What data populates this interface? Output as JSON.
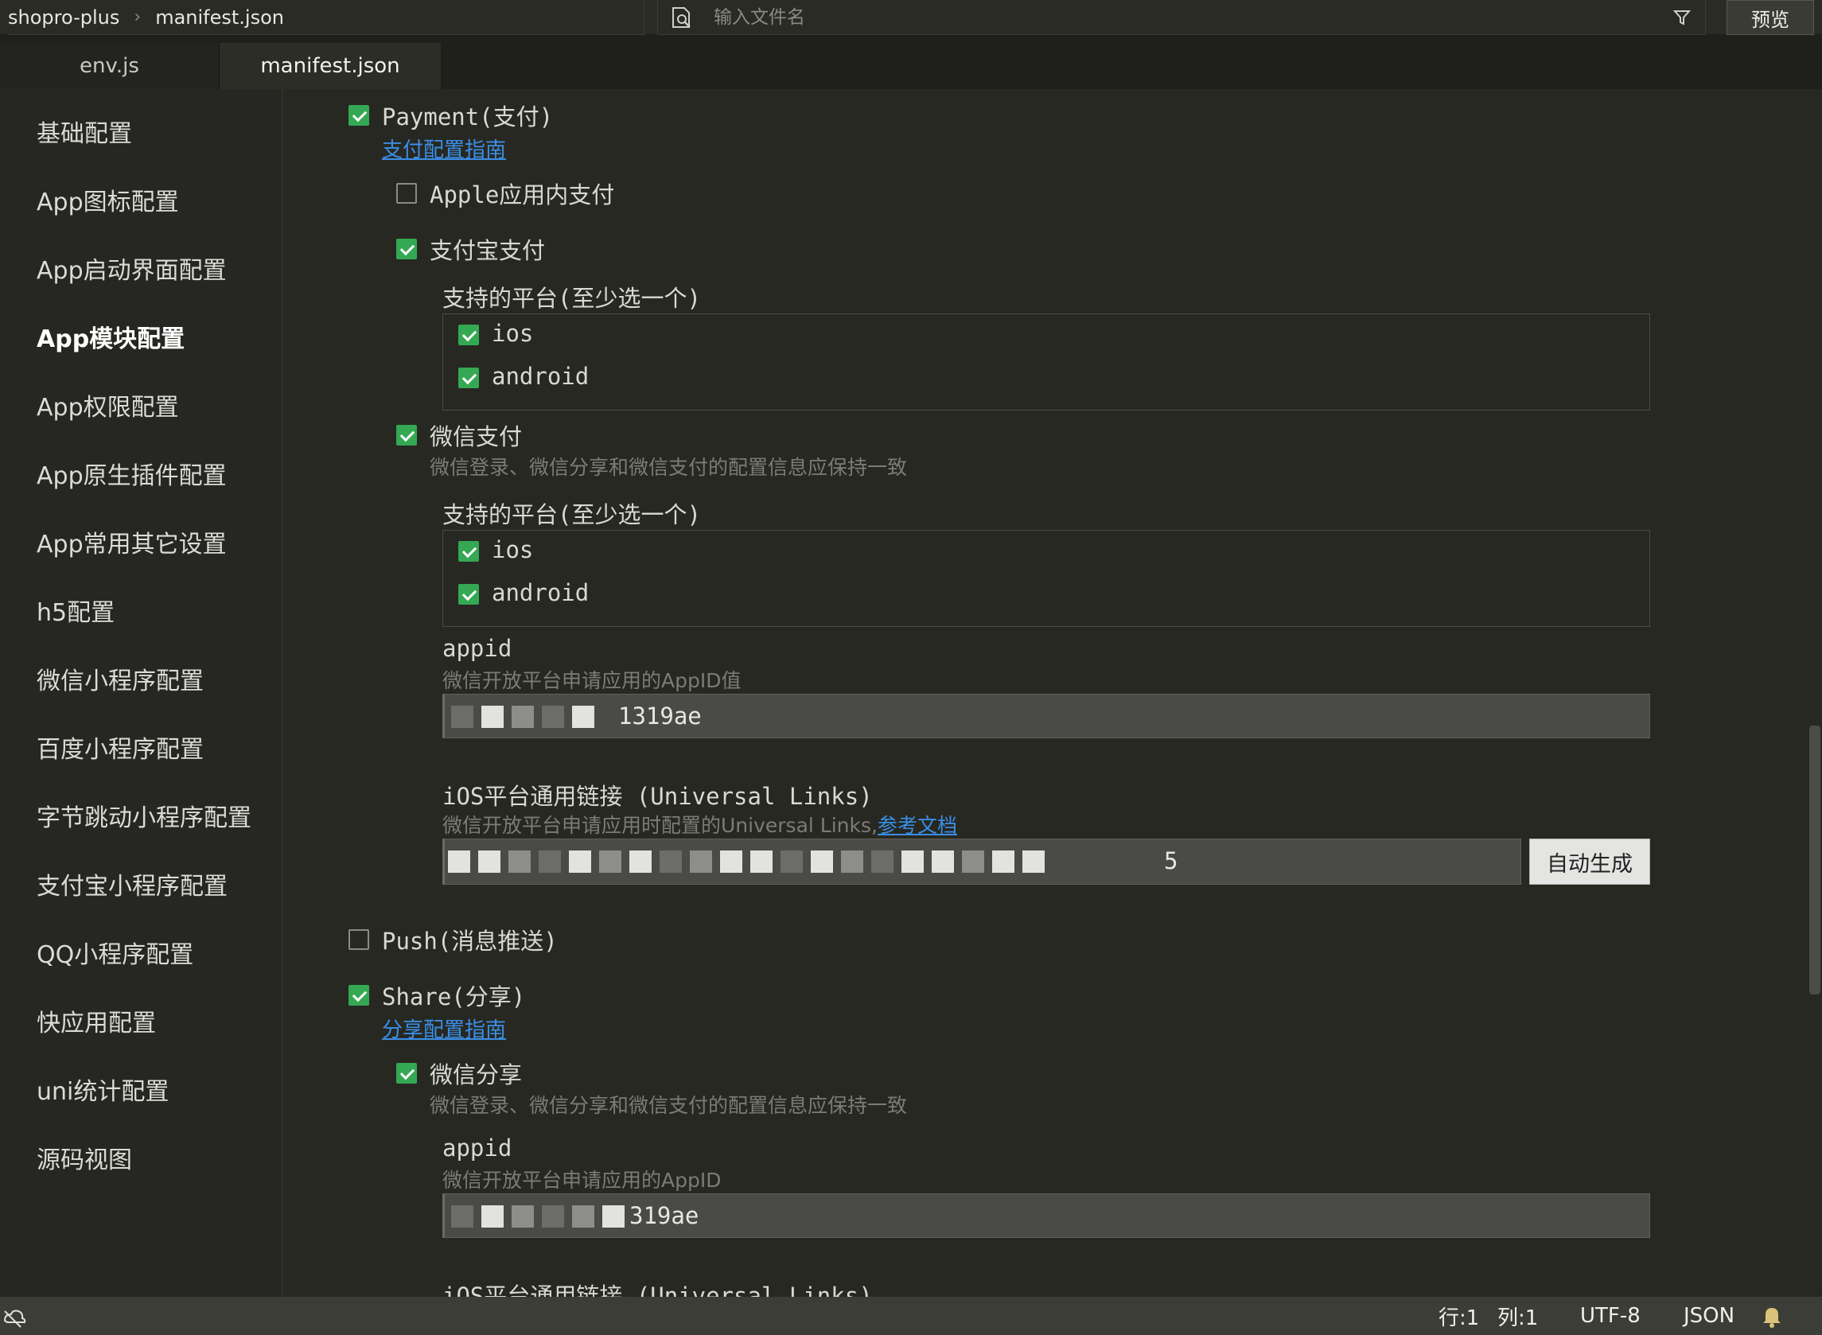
{
  "topbar": {
    "project": "shopro-plus",
    "separator": "›",
    "file": "manifest.json",
    "search_placeholder": "输入文件名",
    "preview_label": "预览"
  },
  "tabs": [
    {
      "label": "env.js",
      "active": false
    },
    {
      "label": "manifest.json",
      "active": true
    }
  ],
  "sidebar": {
    "items": [
      {
        "label": "基础配置"
      },
      {
        "label": "App图标配置"
      },
      {
        "label": "App启动界面配置"
      },
      {
        "label": "App模块配置",
        "active": true
      },
      {
        "label": "App权限配置"
      },
      {
        "label": "App原生插件配置"
      },
      {
        "label": "App常用其它设置"
      },
      {
        "label": "h5配置"
      },
      {
        "label": "微信小程序配置"
      },
      {
        "label": "百度小程序配置"
      },
      {
        "label": "字节跳动小程序配置"
      },
      {
        "label": "支付宝小程序配置"
      },
      {
        "label": "QQ小程序配置"
      },
      {
        "label": "快应用配置"
      },
      {
        "label": "uni统计配置"
      },
      {
        "label": "源码视图"
      }
    ]
  },
  "payment": {
    "label": "Payment(支付)",
    "checked": true,
    "guide_link": "支付配置指南",
    "apple": {
      "label": "Apple应用内支付",
      "checked": false
    },
    "alipay": {
      "label": "支付宝支付",
      "checked": true,
      "platforms_label": "支持的平台(至少选一个)",
      "ios": "ios",
      "android": "android"
    },
    "wechat": {
      "label": "微信支付",
      "checked": true,
      "hint": "微信登录、微信分享和微信支付的配置信息应保持一致",
      "platforms_label": "支持的平台(至少选一个)",
      "ios": "ios",
      "android": "android",
      "appid_label": "appid",
      "appid_hint": "微信开放平台申请应用的AppID值",
      "appid_value_suffix": "1319ae",
      "ul_label": "iOS平台通用链接 (Universal Links)",
      "ul_hint": "微信开放平台申请应用时配置的Universal Links,",
      "ul_doc_link": "参考文档",
      "ul_value_suffix": "5",
      "auto_button": "自动生成"
    }
  },
  "push": {
    "label": "Push(消息推送)",
    "checked": false
  },
  "share": {
    "label": "Share(分享)",
    "checked": true,
    "guide_link": "分享配置指南",
    "wechat": {
      "label": "微信分享",
      "checked": true,
      "hint": "微信登录、微信分享和微信支付的配置信息应保持一致",
      "appid_label": "appid",
      "appid_hint": "微信开放平台申请应用的AppID",
      "appid_value_suffix": "319ae",
      "ul_label": "iOS平台通用链接 (Universal Links)"
    }
  },
  "statusbar": {
    "row": "行:1",
    "col": "列:1",
    "encoding": "UTF-8",
    "language": "JSON"
  }
}
